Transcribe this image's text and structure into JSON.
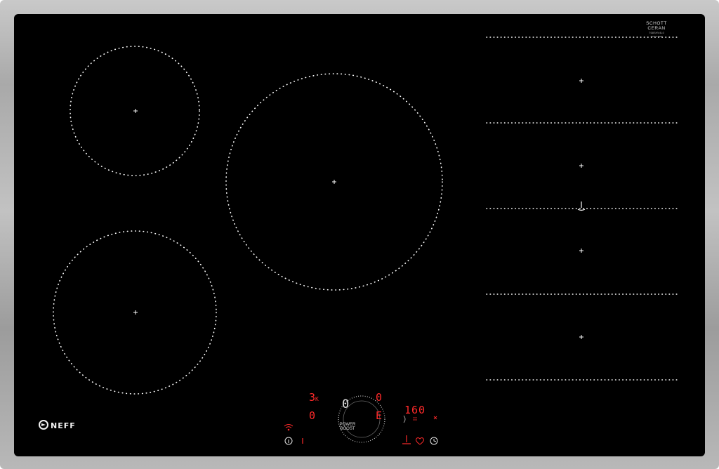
{
  "appliance": {
    "brand": "NEFF",
    "glass_brand_line1": "SCHOTT",
    "glass_brand_line2": "CERAN",
    "model_code": "T68SHV4L0",
    "serial_code": "9001713887"
  },
  "zones": {
    "circles": [
      {
        "name": "top-left-cooking-zone"
      },
      {
        "name": "bottom-left-cooking-zone"
      },
      {
        "name": "centre-large-cooking-zone"
      }
    ],
    "flex_zone_sections": 4
  },
  "display": {
    "left_top": "3",
    "left_top_sub": "K",
    "left_bottom": "0",
    "center": "0",
    "right_top": "0",
    "right_bottom": "E",
    "timer": "160",
    "power_boost_line1": "POWER",
    "power_boost_line2": "BOOST"
  },
  "colors": {
    "glass": "#000000",
    "frame": "#b8b8b8",
    "zone_marks": "#ffffff",
    "display_red": "#ff2a2a"
  },
  "icons": [
    "wifi-icon",
    "info-icon",
    "temperature-probe-icon",
    "favourite-heart-icon",
    "timer-clock-icon",
    "lock-icon",
    "hob-to-hood-icon"
  ]
}
